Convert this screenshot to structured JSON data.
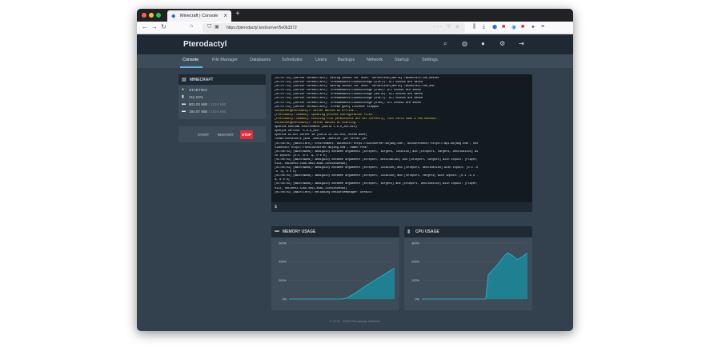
{
  "browser": {
    "tab_title": "Minecraft | Console",
    "new_tab": "+",
    "tab_close": "×",
    "url": "https://pterodactyl.test/server/5e0b3372",
    "url_right": "··· ♡ ☆",
    "traffic_colors": [
      "#ff5f57",
      "#febc2e",
      "#28c840"
    ]
  },
  "app": {
    "brand": "Pterodactyl",
    "nav": [
      "Console",
      "File Manager",
      "Databases",
      "Schedules",
      "Users",
      "Backups",
      "Network",
      "Startup",
      "Settings"
    ],
    "active_nav": "Console",
    "accent": "#5eb3e6"
  },
  "server": {
    "name": "MINECRAFT",
    "status": "STARTING",
    "cpu": "211.19%",
    "memory_used": "801.02 MiB",
    "memory_limit": "/ 1024 MiB",
    "disk_used": "184.57 MiB",
    "disk_limit": "/ 1024 MiB",
    "status_color": "#f7c948"
  },
  "power": {
    "start": "START",
    "restart": "RESTART",
    "stop": "STOP"
  },
  "console": {
    "lines": [
      {
        "t": "[01:07:54] [Server thread/INFO]: Saving chunks for level 'ServerLevel[world]'/minecraft:the_nether",
        "w": false
      },
      {
        "t": "[01:07:54] [Server thread/INFO]: ThreadedAnvilChunkStorage (DIM-1): All chunks are saved",
        "w": false
      },
      {
        "t": "[01:07:54] [Server thread/INFO]: Saving chunks for level 'ServerLevel[world]'/minecraft:the_end",
        "w": false
      },
      {
        "t": "[01:07:54] [Server thread/INFO]: ThreadedAnvilChunkStorage (DIM1): All chunks are saved",
        "w": false
      },
      {
        "t": "[01:07:54] [Server thread/INFO]: ThreadedAnvilChunkStorage (world): All chunks are saved",
        "w": false
      },
      {
        "t": "[01:07:54] [Server thread/INFO]: ThreadedAnvilChunkStorage (DIM-1): All chunks are saved",
        "w": false
      },
      {
        "t": "[01:07:54] [Server thread/INFO]: ThreadedAnvilChunkStorage (DIM1): All chunks are saved",
        "w": false
      },
      {
        "t": "[01:07:54] [Server thread/INFO]: Thread Query Listener stopped",
        "w": false
      },
      {
        "t": "container@pterodactyl~ Server marked as offline...",
        "w": true
      },
      {
        "t": "[Pterodactyl Daemon]: Updating process configuration files...",
        "w": true
      },
      {
        "t": "[Pterodactyl Daemon]: Ensuring file permissions are set correctly, this could take a few seconds...",
        "w": true
      },
      {
        "t": "container@pterodactyl~ Server marked as starting...",
        "w": true
      },
      {
        "t": "OpenJDK Runtime Environment (build 1.8.0_262-b10)",
        "w": false
      },
      {
        "t": "openjdk version \"1.8.0_262\"",
        "w": false
      },
      {
        "t": "OpenJDK 64-Bit Server VM (build 25.262-b10, mixed mode)",
        "w": false
      },
      {
        "t": "/home/container$ java -Xms128M -Xmx512M -jar server.jar",
        "w": false
      },
      {
        "t": "[01:08:01] [main/INFO]: Environment: authHost='https://authserver.mojang.com', accountsHost='https://api.mojang.com', ses",
        "w": false
      },
      {
        "t": "sionHost='https://sessionserver.mojang.com', name='PROD'",
        "w": false
      },
      {
        "t": "[01:08:03] [main/WARN]: Ambiguity between arguments [teleport, targets, location] and [teleport, targets, destination] wi",
        "w": false
      },
      {
        "t": "th inputs: [0.1 -0.5 .9, 0 0 0]",
        "w": false
      },
      {
        "t": "[01:08:03] [main/WARN]: Ambiguity between arguments [teleport, destination] and [teleport, targets] with inputs: [Player,",
        "w": false
      },
      {
        "t": "0123, dd12be42-52a9-4a91-a8a1-11c01849e498]",
        "w": false
      },
      {
        "t": "[01:08:03] [main/WARN]: Ambiguity between arguments [teleport, location] and [teleport, destination] with inputs: [0.1 -0",
        "w": false
      },
      {
        "t": ".5 .9, 0 0 0]",
        "w": false
      },
      {
        "t": "[01:08:03] [main/WARN]: Ambiguity between arguments [teleport, location] and [teleport, targets] with inputs: [0.1 -0.5 .",
        "w": false
      },
      {
        "t": "9, 0 0 0]",
        "w": false
      },
      {
        "t": "[01:08:03] [main/WARN]: Ambiguity between arguments [teleport, targets] and [teleport, destination] with inputs: [Player,",
        "w": false
      },
      {
        "t": "0123, dd12be42-52a9-4a91-a8a1-11c01849e498]",
        "w": false
      },
      {
        "t": "[01:08:03] [main/INFO]: Reloading ResourceManager: Default",
        "w": false
      }
    ],
    "prompt": "$"
  },
  "graphs": {
    "memory": {
      "title": "MEMORY USAGE",
      "ticks": [
        "600%",
        "400%",
        "200%",
        "0%"
      ],
      "values": [
        0,
        0,
        0,
        0,
        0,
        0,
        0,
        0,
        0,
        0,
        0,
        0,
        0,
        0,
        0,
        0,
        0,
        0,
        0,
        0,
        0,
        0,
        2,
        8,
        18,
        32,
        48,
        64,
        82,
        100,
        118,
        136,
        154,
        170,
        186,
        202,
        220,
        236,
        252,
        268,
        284,
        300,
        316,
        332
      ]
    },
    "cpu": {
      "title": "CPU USAGE",
      "ticks": [
        "300%",
        "200%",
        "100%",
        "0%"
      ],
      "values": [
        0,
        0,
        0,
        0,
        0,
        0,
        0,
        0,
        0,
        0,
        0,
        0,
        0,
        0,
        0,
        0,
        0,
        0,
        0,
        0,
        0,
        0,
        0,
        0,
        0,
        0,
        0,
        130,
        145,
        158,
        172,
        188,
        205,
        222,
        238,
        248,
        240,
        232,
        220,
        212,
        220,
        228,
        238,
        246
      ],
      "fill_color": "#2ab7ca"
    }
  },
  "footer": "© 2015 - 2020 Pterodactyl Software"
}
